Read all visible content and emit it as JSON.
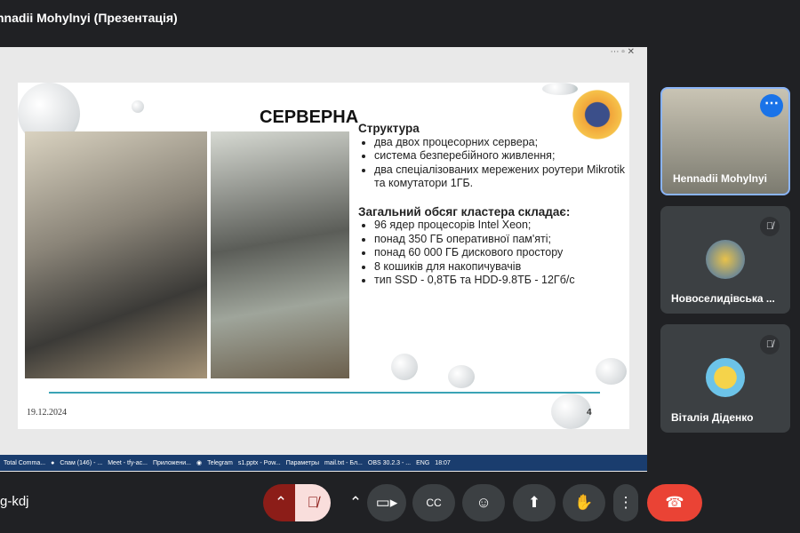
{
  "title": "nnadii Mohylnyi (Презентація)",
  "slide": {
    "heading": "СЕРВЕРНА",
    "structure_title": "Структура",
    "structure": [
      "два двох процесорних сервера;",
      "система безперебійного живлення;",
      "два спеціалізованих мережених роутери Mikrotik та комутатори 1ГБ."
    ],
    "cluster_title": "Загальний обсяг кластера складає:",
    "cluster": [
      "96 ядер процесорів Intel Xeon;",
      "понад 350 ГБ оперативної пам'яті;",
      "понад 60 000 ГБ дискового простору",
      "8 кошиків для накопичувачів",
      "тип SSD - 0,8ТБ та HDD-9.8ТБ - 12Гб/с"
    ],
    "date": "19.12.2024",
    "page": "4"
  },
  "taskbar": {
    "items": [
      "Total Comma...",
      "Спам (146) - ...",
      "Meet - tfy-ac...",
      "Приложени...",
      "Telegram",
      "s1.pptx - Pow...",
      "Параметры",
      "mail.txt - Бл...",
      "OBS 30.2.3 - ..."
    ],
    "lang": "ENG",
    "time": "18:07"
  },
  "participants": [
    {
      "name": "Hennadii Mohylnyi"
    },
    {
      "name": "Новоселидівська ..."
    },
    {
      "name": "Віталія Діденко"
    }
  ],
  "meeting_code": "g-kdj"
}
